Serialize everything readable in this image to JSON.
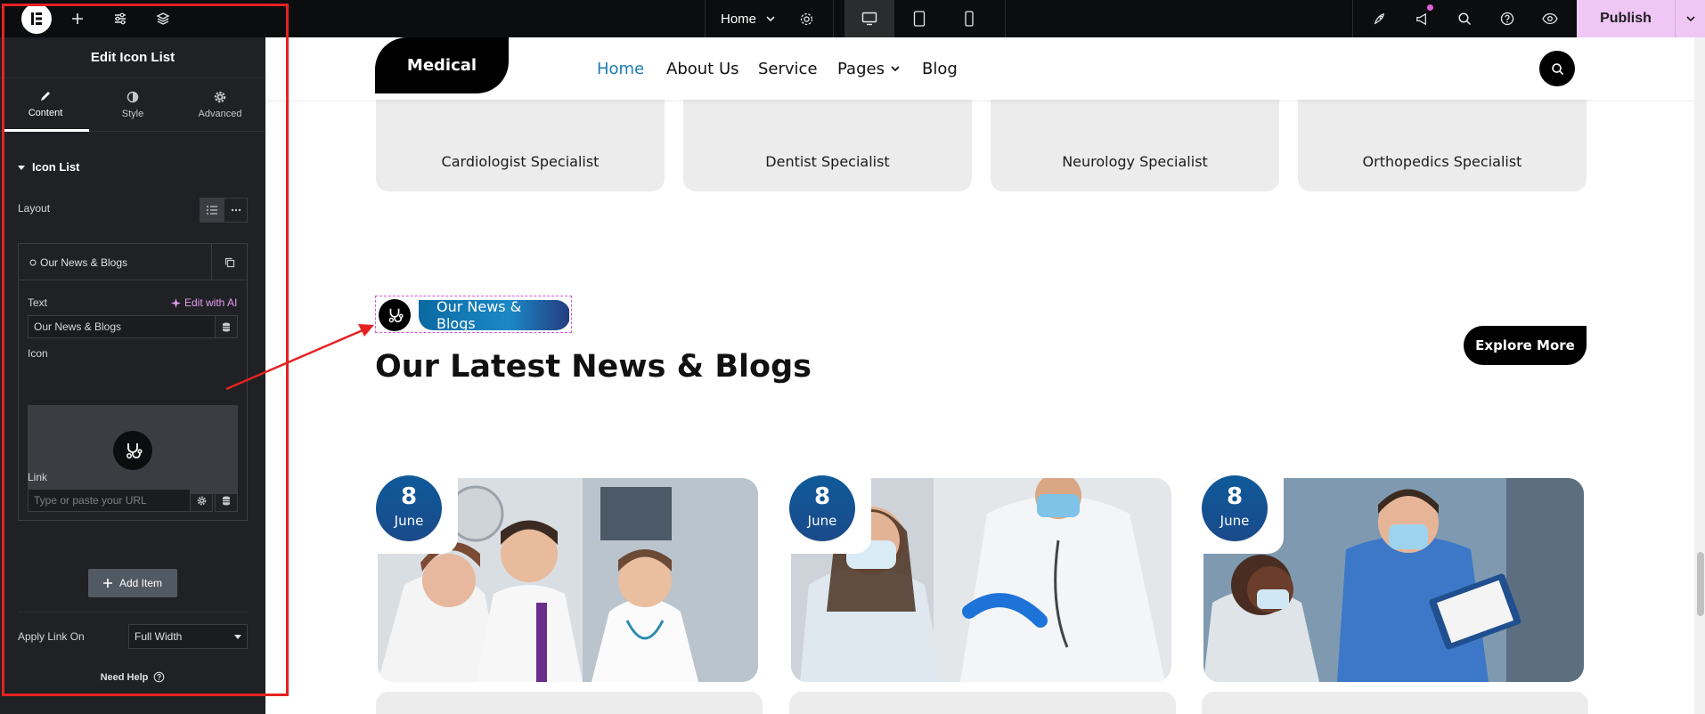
{
  "topbar": {
    "page_name": "Home",
    "publish_label": "Publish"
  },
  "panel": {
    "title": "Edit Icon List",
    "tabs": [
      {
        "label": "Content",
        "icon": "pencil-icon"
      },
      {
        "label": "Style",
        "icon": "half-circle-icon"
      },
      {
        "label": "Advanced",
        "icon": "gear-icon"
      }
    ],
    "section_title": "Icon List",
    "layout_label": "Layout",
    "repeater_item_title": "Our News & Blogs",
    "text_label": "Text",
    "edit_with_ai": "Edit with AI",
    "text_value": "Our News & Blogs",
    "icon_label": "Icon",
    "link_label": "Link",
    "link_placeholder": "Type or paste your URL",
    "add_item_label": "Add Item",
    "apply_link_label": "Apply Link On",
    "apply_link_value": "Full Width",
    "need_help": "Need Help"
  },
  "site": {
    "logo_text": "Medical",
    "nav": [
      "Home",
      "About Us",
      "Service",
      "Pages",
      "Blog"
    ],
    "specialists": [
      "Cardiologist Specialist",
      "Dentist Specialist",
      "Neurology Specialist",
      "Orthopedics Specialist"
    ],
    "badge_text": "Our News & Blogs",
    "section_title": "Our Latest News & Blogs",
    "explore_label": "Explore More",
    "blog_cards": [
      {
        "day": "8",
        "month": "June"
      },
      {
        "day": "8",
        "month": "June"
      },
      {
        "day": "8",
        "month": "June"
      }
    ]
  },
  "colors": {
    "accent_pink": "#f0c6f4",
    "nav_active": "#1b7bb0",
    "annotation_red": "#e52222"
  }
}
